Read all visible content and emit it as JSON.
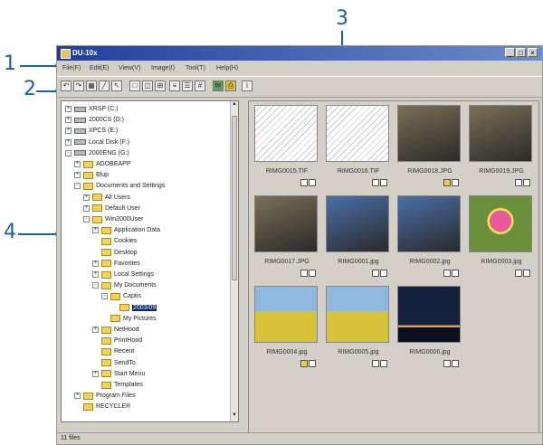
{
  "callouts": [
    "1",
    "2",
    "3",
    "4"
  ],
  "window": {
    "title": "DU-10x",
    "min_label": "_",
    "max_label": "□",
    "close_label": "×"
  },
  "menu": [
    "File(F)",
    "Edit(E)",
    "View(V)",
    "Image(I)",
    "Tool(T)",
    "Help(H)"
  ],
  "toolbar_icons": [
    "rotate-left-icon",
    "rotate-right-icon",
    "slideshow-icon",
    "pen-icon",
    "arrow-icon",
    "single-view-icon",
    "dual-view-icon",
    "grid-view-icon",
    "list-view-icon",
    "detail-view-icon",
    "thumbnail-view-icon",
    "mail-icon",
    "print-icon",
    "info-icon"
  ],
  "tree": [
    {
      "label": "XRSP (C:)",
      "type": "drive"
    },
    {
      "label": "2000CS (D:)",
      "type": "drive"
    },
    {
      "label": "XPCS (E:)",
      "type": "drive"
    },
    {
      "label": "Local Disk (F:)",
      "type": "drive"
    },
    {
      "label": "2000ENG (G:)",
      "type": "drive"
    },
    {
      "label": "ADOBEAPP",
      "type": "folder"
    },
    {
      "label": "Blup",
      "type": "folder"
    },
    {
      "label": "Documents and Settings",
      "type": "folder"
    },
    {
      "label": "All Users",
      "type": "folder"
    },
    {
      "label": "Default User",
      "type": "folder"
    },
    {
      "label": "Win2000User",
      "type": "folder"
    },
    {
      "label": "Application Data",
      "type": "folder"
    },
    {
      "label": "Cookies",
      "type": "folder"
    },
    {
      "label": "Desktop",
      "type": "folder"
    },
    {
      "label": "Favorites",
      "type": "folder"
    },
    {
      "label": "Local Settings",
      "type": "folder"
    },
    {
      "label": "My Documents",
      "type": "folder"
    },
    {
      "label": "Captis",
      "type": "folder"
    },
    {
      "label": "2003/09",
      "type": "folder",
      "selected": true
    },
    {
      "label": "My Pictures",
      "type": "folder"
    },
    {
      "label": "NetHood",
      "type": "folder"
    },
    {
      "label": "PrintHood",
      "type": "folder"
    },
    {
      "label": "Recent",
      "type": "folder"
    },
    {
      "label": "SendTo",
      "type": "folder"
    },
    {
      "label": "Start Menu",
      "type": "folder"
    },
    {
      "label": "Templates",
      "type": "folder"
    },
    {
      "label": "Program Files",
      "type": "folder"
    },
    {
      "label": "RECYCLER",
      "type": "folder"
    }
  ],
  "thumbnails": [
    {
      "name": "RIMG0015.TIF",
      "kind": "sketch"
    },
    {
      "name": "RIMG0016.TIF",
      "kind": "sketch"
    },
    {
      "name": "RIMG0018.JPG",
      "kind": "room"
    },
    {
      "name": "RIMG0019.JPG",
      "kind": "room"
    },
    {
      "name": "RIMG0017.JPG",
      "kind": "room"
    },
    {
      "name": "RIMG0001.jpg",
      "kind": "building"
    },
    {
      "name": "RIMG0002.jpg",
      "kind": "building"
    },
    {
      "name": "RIMG0003.jpg",
      "kind": "flower"
    },
    {
      "name": "RIMG0004.jpg",
      "kind": "field"
    },
    {
      "name": "RIMG0005.jpg",
      "kind": "field"
    },
    {
      "name": "RIMG0006.jpg",
      "kind": "night"
    }
  ],
  "photo_colors": {
    "sketch": "#f2f2f2",
    "room": "#7a7055",
    "building": "#4a6fa8",
    "flower": "#6b8f3a",
    "field": "#d8c23a",
    "night": "#15213a"
  },
  "status": "11 files",
  "accent": "#1a5fa8"
}
